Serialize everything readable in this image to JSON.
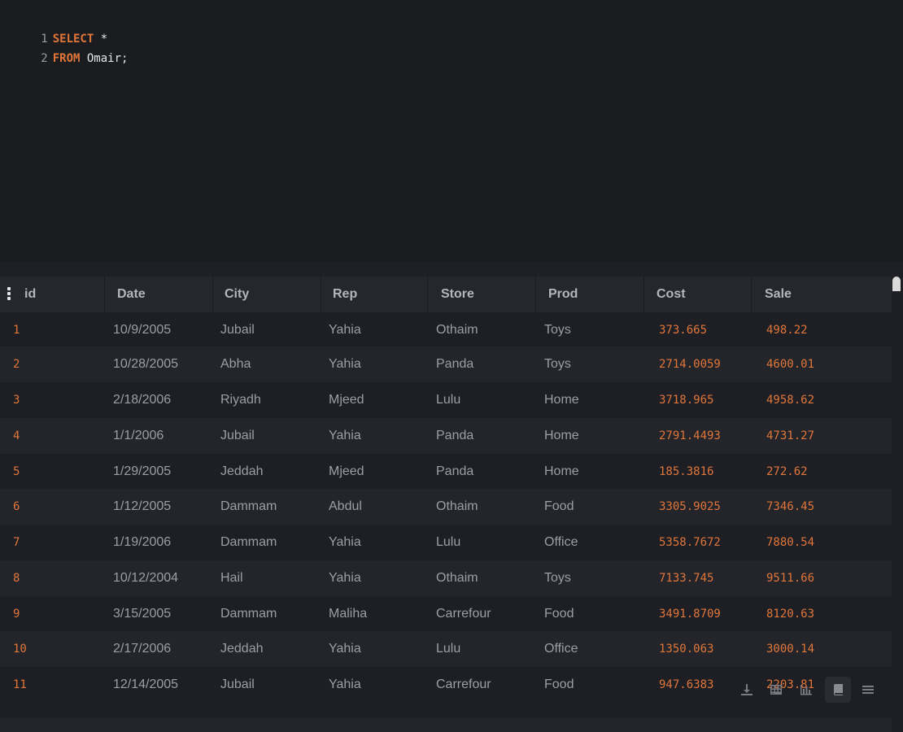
{
  "editor": {
    "lines": [
      {
        "no": "1",
        "kw": "SELECT",
        "rest": " *"
      },
      {
        "no": "2",
        "kw": "FROM",
        "rest": " Omair;"
      }
    ]
  },
  "table": {
    "columns": [
      "id",
      "Date",
      "City",
      "Rep",
      "Store",
      "Prod",
      "Cost",
      "Sale"
    ],
    "rows": [
      [
        "1",
        "10/9/2005",
        "Jubail",
        "Yahia",
        "Othaim",
        "Toys",
        "373.665",
        "498.22"
      ],
      [
        "2",
        "10/28/2005",
        "Abha",
        "Yahia",
        "Panda",
        "Toys",
        "2714.0059",
        "4600.01"
      ],
      [
        "3",
        "2/18/2006",
        "Riyadh",
        "Mjeed",
        "Lulu",
        "Home",
        "3718.965",
        "4958.62"
      ],
      [
        "4",
        "1/1/2006",
        "Jubail",
        "Yahia",
        "Panda",
        "Home",
        "2791.4493",
        "4731.27"
      ],
      [
        "5",
        "1/29/2005",
        "Jeddah",
        "Mjeed",
        "Panda",
        "Home",
        "185.3816",
        "272.62"
      ],
      [
        "6",
        "1/12/2005",
        "Dammam",
        "Abdul",
        "Othaim",
        "Food",
        "3305.9025",
        "7346.45"
      ],
      [
        "7",
        "1/19/2006",
        "Dammam",
        "Yahia",
        "Lulu",
        "Office",
        "5358.7672",
        "7880.54"
      ],
      [
        "8",
        "10/12/2004",
        "Hail",
        "Yahia",
        "Othaim",
        "Toys",
        "7133.745",
        "9511.66"
      ],
      [
        "9",
        "3/15/2005",
        "Dammam",
        "Maliha",
        "Carrefour",
        "Food",
        "3491.8709",
        "8120.63"
      ],
      [
        "10",
        "2/17/2006",
        "Jeddah",
        "Yahia",
        "Lulu",
        "Office",
        "1350.063",
        "3000.14"
      ],
      [
        "11",
        "12/14/2005",
        "Jubail",
        "Yahia",
        "Carrefour",
        "Food",
        "947.6383",
        "2203.81"
      ]
    ]
  },
  "toolbar": {
    "icons": [
      "download-icon",
      "table-view-icon",
      "chart-view-icon",
      "notebook-icon",
      "menu-icon"
    ]
  }
}
